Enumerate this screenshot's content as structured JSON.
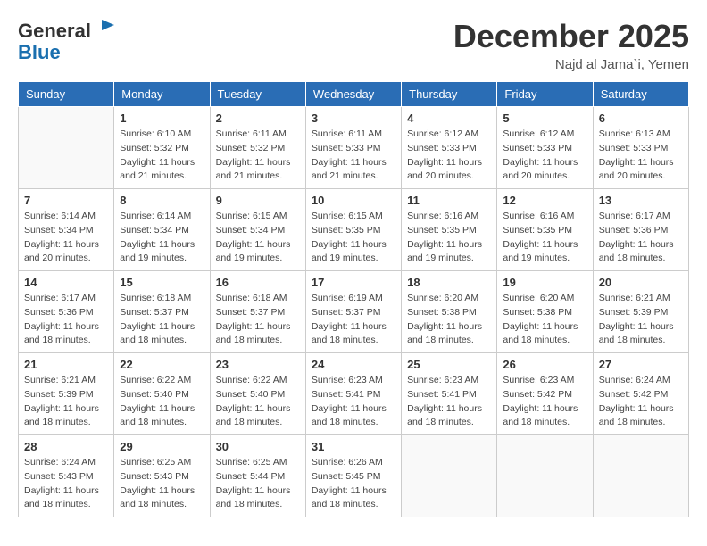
{
  "header": {
    "logo_line1": "General",
    "logo_line2": "Blue",
    "month_title": "December 2025",
    "location": "Najd al Jama`i, Yemen"
  },
  "weekdays": [
    "Sunday",
    "Monday",
    "Tuesday",
    "Wednesday",
    "Thursday",
    "Friday",
    "Saturday"
  ],
  "weeks": [
    [
      {
        "day": "",
        "info": ""
      },
      {
        "day": "1",
        "info": "Sunrise: 6:10 AM\nSunset: 5:32 PM\nDaylight: 11 hours\nand 21 minutes."
      },
      {
        "day": "2",
        "info": "Sunrise: 6:11 AM\nSunset: 5:32 PM\nDaylight: 11 hours\nand 21 minutes."
      },
      {
        "day": "3",
        "info": "Sunrise: 6:11 AM\nSunset: 5:33 PM\nDaylight: 11 hours\nand 21 minutes."
      },
      {
        "day": "4",
        "info": "Sunrise: 6:12 AM\nSunset: 5:33 PM\nDaylight: 11 hours\nand 20 minutes."
      },
      {
        "day": "5",
        "info": "Sunrise: 6:12 AM\nSunset: 5:33 PM\nDaylight: 11 hours\nand 20 minutes."
      },
      {
        "day": "6",
        "info": "Sunrise: 6:13 AM\nSunset: 5:33 PM\nDaylight: 11 hours\nand 20 minutes."
      }
    ],
    [
      {
        "day": "7",
        "info": "Sunrise: 6:14 AM\nSunset: 5:34 PM\nDaylight: 11 hours\nand 20 minutes."
      },
      {
        "day": "8",
        "info": "Sunrise: 6:14 AM\nSunset: 5:34 PM\nDaylight: 11 hours\nand 19 minutes."
      },
      {
        "day": "9",
        "info": "Sunrise: 6:15 AM\nSunset: 5:34 PM\nDaylight: 11 hours\nand 19 minutes."
      },
      {
        "day": "10",
        "info": "Sunrise: 6:15 AM\nSunset: 5:35 PM\nDaylight: 11 hours\nand 19 minutes."
      },
      {
        "day": "11",
        "info": "Sunrise: 6:16 AM\nSunset: 5:35 PM\nDaylight: 11 hours\nand 19 minutes."
      },
      {
        "day": "12",
        "info": "Sunrise: 6:16 AM\nSunset: 5:35 PM\nDaylight: 11 hours\nand 19 minutes."
      },
      {
        "day": "13",
        "info": "Sunrise: 6:17 AM\nSunset: 5:36 PM\nDaylight: 11 hours\nand 18 minutes."
      }
    ],
    [
      {
        "day": "14",
        "info": "Sunrise: 6:17 AM\nSunset: 5:36 PM\nDaylight: 11 hours\nand 18 minutes."
      },
      {
        "day": "15",
        "info": "Sunrise: 6:18 AM\nSunset: 5:37 PM\nDaylight: 11 hours\nand 18 minutes."
      },
      {
        "day": "16",
        "info": "Sunrise: 6:18 AM\nSunset: 5:37 PM\nDaylight: 11 hours\nand 18 minutes."
      },
      {
        "day": "17",
        "info": "Sunrise: 6:19 AM\nSunset: 5:37 PM\nDaylight: 11 hours\nand 18 minutes."
      },
      {
        "day": "18",
        "info": "Sunrise: 6:20 AM\nSunset: 5:38 PM\nDaylight: 11 hours\nand 18 minutes."
      },
      {
        "day": "19",
        "info": "Sunrise: 6:20 AM\nSunset: 5:38 PM\nDaylight: 11 hours\nand 18 minutes."
      },
      {
        "day": "20",
        "info": "Sunrise: 6:21 AM\nSunset: 5:39 PM\nDaylight: 11 hours\nand 18 minutes."
      }
    ],
    [
      {
        "day": "21",
        "info": "Sunrise: 6:21 AM\nSunset: 5:39 PM\nDaylight: 11 hours\nand 18 minutes."
      },
      {
        "day": "22",
        "info": "Sunrise: 6:22 AM\nSunset: 5:40 PM\nDaylight: 11 hours\nand 18 minutes."
      },
      {
        "day": "23",
        "info": "Sunrise: 6:22 AM\nSunset: 5:40 PM\nDaylight: 11 hours\nand 18 minutes."
      },
      {
        "day": "24",
        "info": "Sunrise: 6:23 AM\nSunset: 5:41 PM\nDaylight: 11 hours\nand 18 minutes."
      },
      {
        "day": "25",
        "info": "Sunrise: 6:23 AM\nSunset: 5:41 PM\nDaylight: 11 hours\nand 18 minutes."
      },
      {
        "day": "26",
        "info": "Sunrise: 6:23 AM\nSunset: 5:42 PM\nDaylight: 11 hours\nand 18 minutes."
      },
      {
        "day": "27",
        "info": "Sunrise: 6:24 AM\nSunset: 5:42 PM\nDaylight: 11 hours\nand 18 minutes."
      }
    ],
    [
      {
        "day": "28",
        "info": "Sunrise: 6:24 AM\nSunset: 5:43 PM\nDaylight: 11 hours\nand 18 minutes."
      },
      {
        "day": "29",
        "info": "Sunrise: 6:25 AM\nSunset: 5:43 PM\nDaylight: 11 hours\nand 18 minutes."
      },
      {
        "day": "30",
        "info": "Sunrise: 6:25 AM\nSunset: 5:44 PM\nDaylight: 11 hours\nand 18 minutes."
      },
      {
        "day": "31",
        "info": "Sunrise: 6:26 AM\nSunset: 5:45 PM\nDaylight: 11 hours\nand 18 minutes."
      },
      {
        "day": "",
        "info": ""
      },
      {
        "day": "",
        "info": ""
      },
      {
        "day": "",
        "info": ""
      }
    ]
  ]
}
